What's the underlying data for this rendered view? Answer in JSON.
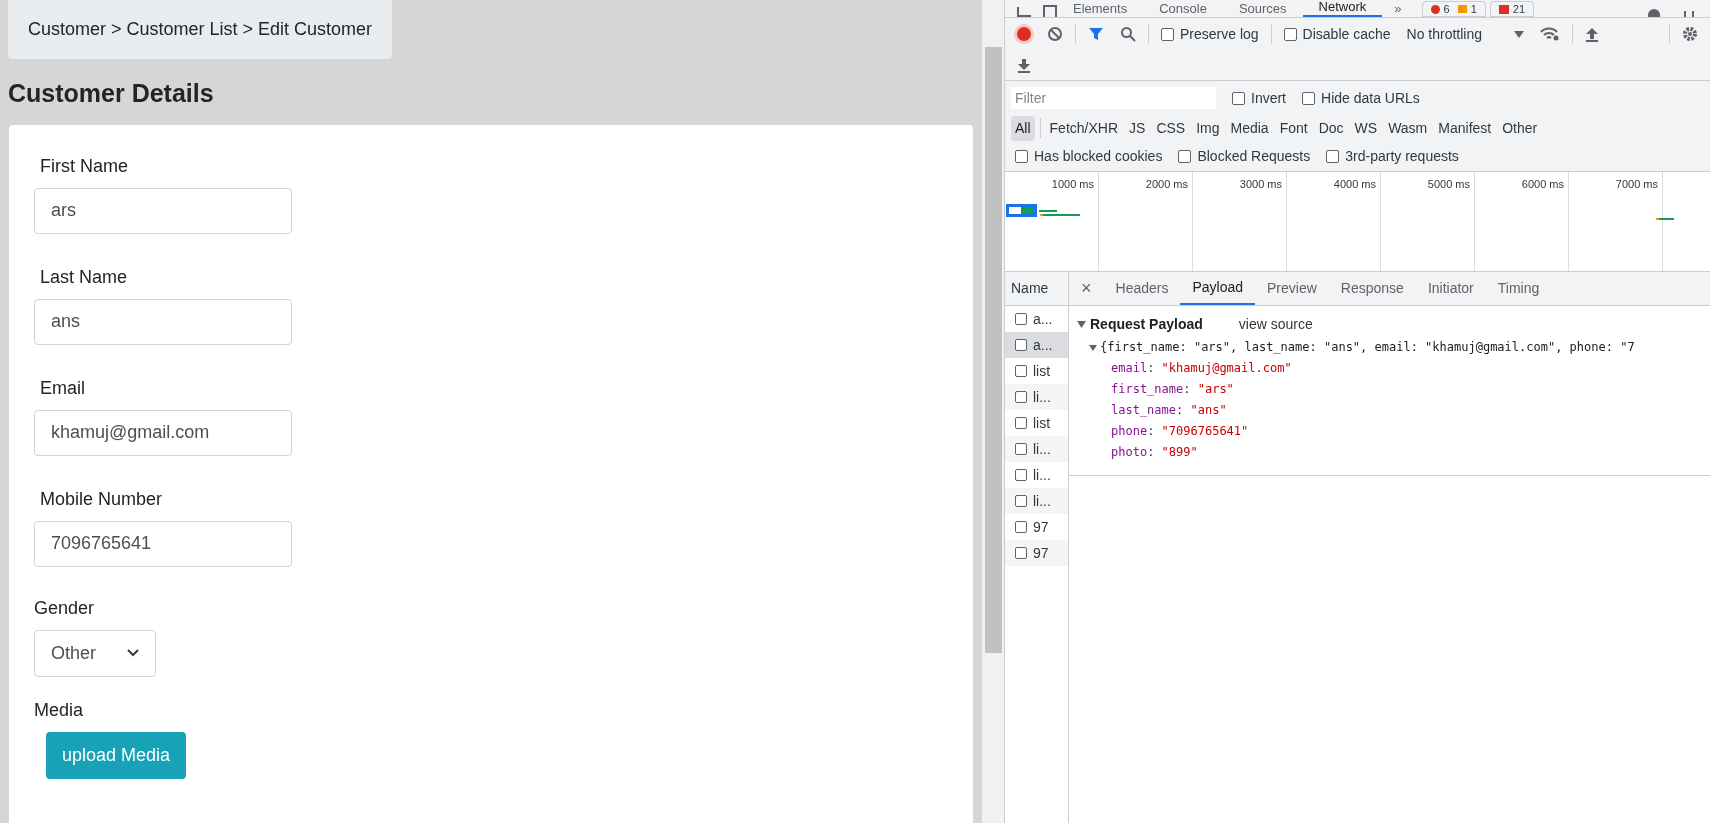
{
  "page": {
    "breadcrumb": "Customer > Customer List > Edit Customer",
    "heading": "Customer Details",
    "fields": [
      {
        "label": "First Name",
        "value": "ars"
      },
      {
        "label": "Last Name",
        "value": "ans"
      },
      {
        "label": "Email",
        "value": "khamuj@gmail.com"
      },
      {
        "label": "Mobile Number",
        "value": "7096765641"
      }
    ],
    "gender": {
      "label": "Gender",
      "value": "Other"
    },
    "media": {
      "label": "Media",
      "button": "upload Media"
    }
  },
  "devtools": {
    "tabs": [
      {
        "label": "Elements",
        "selected": false
      },
      {
        "label": "Console",
        "selected": false
      },
      {
        "label": "Sources",
        "selected": false
      },
      {
        "label": "Network",
        "selected": true
      }
    ],
    "more": "»",
    "errors": "6",
    "warnings": "1",
    "issues": "21",
    "toolbar": {
      "recording": true,
      "preserve_log": {
        "label": "Preserve log",
        "checked": false
      },
      "disable_cache": {
        "label": "Disable cache",
        "checked": false
      },
      "throttling": "No throttling"
    },
    "filter": {
      "placeholder": "Filter",
      "invert": {
        "label": "Invert",
        "checked": false
      },
      "hide_data_urls": {
        "label": "Hide data URLs",
        "checked": false
      }
    },
    "types": [
      {
        "label": "All",
        "selected": true
      },
      {
        "label": "Fetch/XHR",
        "selected": false
      },
      {
        "label": "JS",
        "selected": false
      },
      {
        "label": "CSS",
        "selected": false
      },
      {
        "label": "Img",
        "selected": false
      },
      {
        "label": "Media",
        "selected": false
      },
      {
        "label": "Font",
        "selected": false
      },
      {
        "label": "Doc",
        "selected": false
      },
      {
        "label": "WS",
        "selected": false
      },
      {
        "label": "Wasm",
        "selected": false
      },
      {
        "label": "Manifest",
        "selected": false
      },
      {
        "label": "Other",
        "selected": false
      }
    ],
    "blocked": [
      {
        "label": "Has blocked cookies",
        "checked": false
      },
      {
        "label": "Blocked Requests",
        "checked": false
      },
      {
        "label": "3rd-party requests",
        "checked": false
      }
    ],
    "timeline": {
      "ticks": [
        "1000 ms",
        "2000 ms",
        "3000 ms",
        "4000 ms",
        "5000 ms",
        "6000 ms",
        "7000 ms"
      ]
    },
    "name_header": "Name",
    "requests": [
      {
        "name": "a...",
        "selected": false
      },
      {
        "name": "a...",
        "selected": true
      },
      {
        "name": "list",
        "selected": false
      },
      {
        "name": "li...",
        "selected": false
      },
      {
        "name": "list",
        "selected": false
      },
      {
        "name": "li...",
        "selected": false
      },
      {
        "name": "li...",
        "selected": false
      },
      {
        "name": "li...",
        "selected": false
      },
      {
        "name": "97",
        "selected": false
      },
      {
        "name": "97",
        "selected": false
      }
    ],
    "close": "×",
    "detail_tabs": [
      {
        "label": "Headers",
        "selected": false
      },
      {
        "label": "Payload",
        "selected": true
      },
      {
        "label": "Preview",
        "selected": false
      },
      {
        "label": "Response",
        "selected": false
      },
      {
        "label": "Initiator",
        "selected": false
      },
      {
        "label": "Timing",
        "selected": false
      }
    ],
    "payload": {
      "title": "Request Payload",
      "view_source": "view source",
      "expanded": true,
      "summary": "{first_name: \"ars\", last_name: \"ans\", email: \"khamuj@gmail.com\", phone: \"7",
      "entries": [
        {
          "key": "email",
          "sep": ":",
          "value": "\"khamuj@gmail.com\""
        },
        {
          "key": "first_name",
          "sep": ":",
          "value": "\"ars\""
        },
        {
          "key": "last_name",
          "sep": ":",
          "value": "\"ans\""
        },
        {
          "key": "phone",
          "sep": ":",
          "value": "\"7096765641\""
        },
        {
          "key": "photo",
          "sep": ":",
          "value": "\"899\""
        }
      ]
    }
  }
}
